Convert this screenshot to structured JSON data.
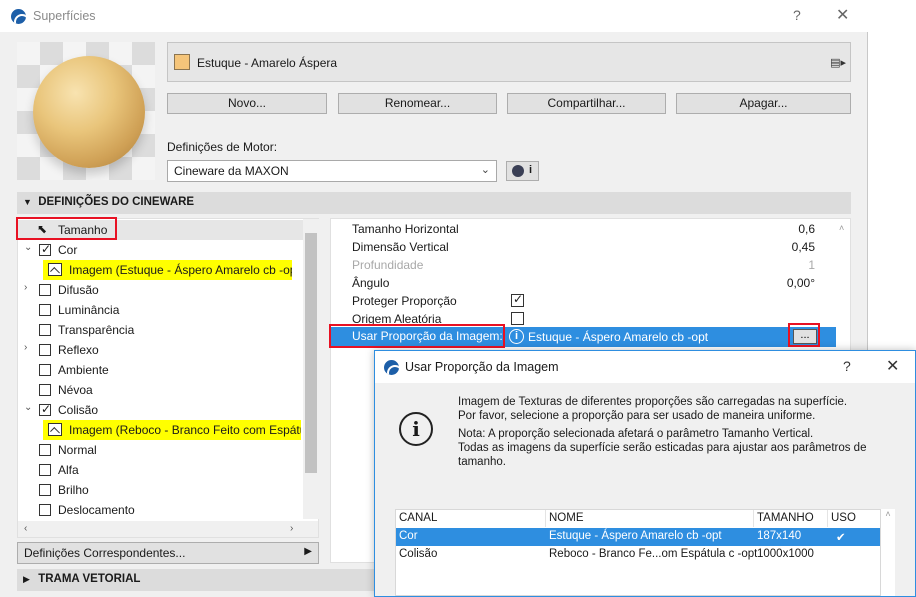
{
  "window": {
    "title": "Superfícies",
    "help_label": "?",
    "close_label": "✕"
  },
  "surface": {
    "name": "Estuque - Amarelo Áspera",
    "swatch_color": "#f5c57a"
  },
  "buttons": {
    "new": "Novo...",
    "rename": "Renomear...",
    "share": "Compartilhar...",
    "delete": "Apagar..."
  },
  "engine": {
    "label": "Definições de Motor:",
    "value": "Cineware da MAXON",
    "info_label": "i"
  },
  "sections": {
    "cineware": "DEFINIÇÕES DO CINEWARE",
    "trama": "TRAMA VETORIAL"
  },
  "tree": {
    "tamanho": "Tamanho",
    "cor": "Cor",
    "cor_texture": "Imagem (Estuque - Áspero Amarelo cb -opt)",
    "difusao": "Difusão",
    "luminancia": "Luminância",
    "transparencia": "Transparência",
    "reflexo": "Reflexo",
    "ambiente": "Ambiente",
    "nevoa": "Névoa",
    "colisao": "Colisão",
    "colisao_texture": "Imagem (Reboco - Branco Feito com Espátula",
    "normal": "Normal",
    "alfa": "Alfa",
    "brilho": "Brilho",
    "deslocamento": "Deslocamento"
  },
  "correspondentes": "Definições Correspondentes...",
  "params": {
    "h_size_label": "Tamanho Horizontal",
    "h_size_value": "0,6",
    "v_dim_label": "Dimensão Vertical",
    "v_dim_value": "0,45",
    "depth_label": "Profundidade",
    "depth_value": "1",
    "angle_label": "Ângulo",
    "angle_value": "0,00°",
    "protect_label": "Proteger Proporção",
    "protect_checked": true,
    "random_label": "Origem Aleatória",
    "random_checked": false,
    "use_ratio_label": "Usar Proporção da Imagem:",
    "use_ratio_value": "Estuque - Áspero Amarelo cb -opt",
    "dots_label": "..."
  },
  "dialog": {
    "title": "Usar Proporção da Imagem",
    "help_label": "?",
    "close_label": "✕",
    "msg1": "Imagem de Texturas de diferentes proporções são carregadas na superfície.",
    "msg2": "Por favor, selecione a proporção para ser usado de maneira uniforme.",
    "msg3": "Nota: A proporção selecionada afetará o parâmetro Tamanho Vertical.",
    "msg4": "Todas as imagens da superfície serão esticadas para ajustar aos parâmetros de",
    "msg5": "tamanho.",
    "headers": {
      "canal": "CANAL",
      "nome": "NOME",
      "tamanho": "TAMANHO",
      "uso": "USO"
    },
    "rows": [
      {
        "canal": "Cor",
        "nome": "Estuque - Áspero Amarelo cb -opt",
        "tamanho": "187x140",
        "uso": "✔"
      },
      {
        "canal": "Colisão",
        "nome": "Reboco - Branco Fe...om Espátula c -opt",
        "tamanho": "1000x1000",
        "uso": ""
      }
    ]
  },
  "colors": {
    "selection": "#2e8ee0",
    "highlight": "#ffff00",
    "callout": "#e81123"
  }
}
